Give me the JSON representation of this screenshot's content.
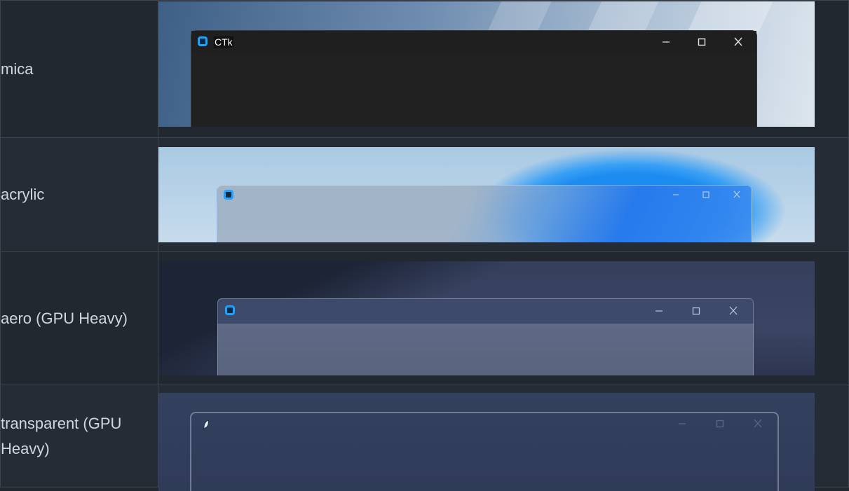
{
  "rows": [
    {
      "label": "mica",
      "preview": {
        "title": "CTk",
        "theme": "dark"
      }
    },
    {
      "label": "acrylic",
      "preview": {
        "title": "",
        "theme": "acrylic"
      }
    },
    {
      "label": "aero (GPU Heavy)",
      "preview": {
        "title": "",
        "theme": "aero"
      }
    },
    {
      "label": "transparent (GPU Heavy)",
      "preview": {
        "title": "",
        "theme": "transparent"
      }
    }
  ],
  "icons": {
    "app": "ctk-app-icon",
    "feather": "tk-feather-icon",
    "minimize": "minimize-icon",
    "maximize": "maximize-icon",
    "close": "close-icon"
  },
  "colors": {
    "page_bg": "#212830",
    "row_alt_bg": "#262c36",
    "border": "#3d444d",
    "text": "#d1d7e0",
    "accent": "#1aa3ff"
  }
}
